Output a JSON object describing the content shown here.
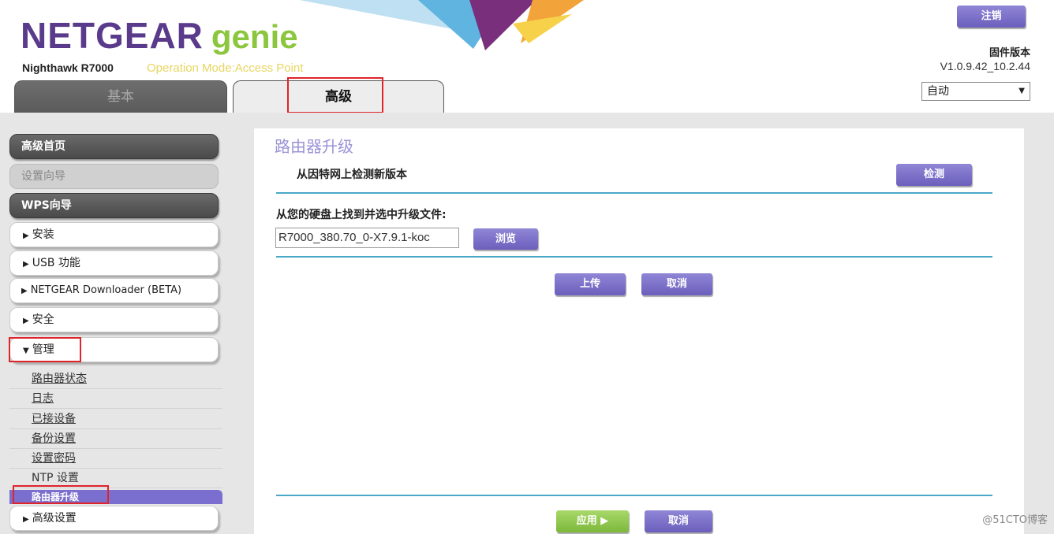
{
  "header": {
    "logo_main": "NETGEAR",
    "logo_genie": "genie",
    "model": "Nighthawk R7000",
    "operation_mode": "Operation Mode:Access Point",
    "tabs": [
      {
        "label": "基本"
      },
      {
        "label": "高级"
      }
    ],
    "logout_label": "注销",
    "firmware_title": "固件版本",
    "firmware_version": "V1.0.9.42_10.2.44",
    "language_value": "自动",
    "colors": {
      "brand_purple": "#5a3a8a",
      "genie_green": "#8cc63e",
      "opmode_yellow": "#e8d560"
    }
  },
  "sidebar": {
    "items": [
      {
        "label": "高级首页"
      },
      {
        "label": "设置向导"
      },
      {
        "label": "WPS向导"
      },
      {
        "label": "安装"
      },
      {
        "label": "USB 功能"
      },
      {
        "label": "NETGEAR Downloader (BETA)"
      },
      {
        "label": "安全"
      },
      {
        "label": "管理"
      }
    ],
    "sub_items": [
      {
        "label": "路由器状态"
      },
      {
        "label": "日志"
      },
      {
        "label": "已接设备"
      },
      {
        "label": "备份设置"
      },
      {
        "label": "设置密码"
      },
      {
        "label": "NTP 设置"
      }
    ],
    "active_sub": "路由器升级",
    "last_item": "高级设置"
  },
  "main": {
    "title": "路由器升级",
    "check_label": "从因特网上检测新版本",
    "check_button": "检测",
    "file_label": "从您的硬盘上找到并选中升级文件:",
    "file_value": "R7000_380.70_0-X7.9.1-koc",
    "browse_button": "浏览",
    "upload_button": "上传",
    "cancel_button": "取消",
    "apply_button": "应用 ▶",
    "cancel_button2": "取消"
  },
  "watermark": "@51CTO博客"
}
